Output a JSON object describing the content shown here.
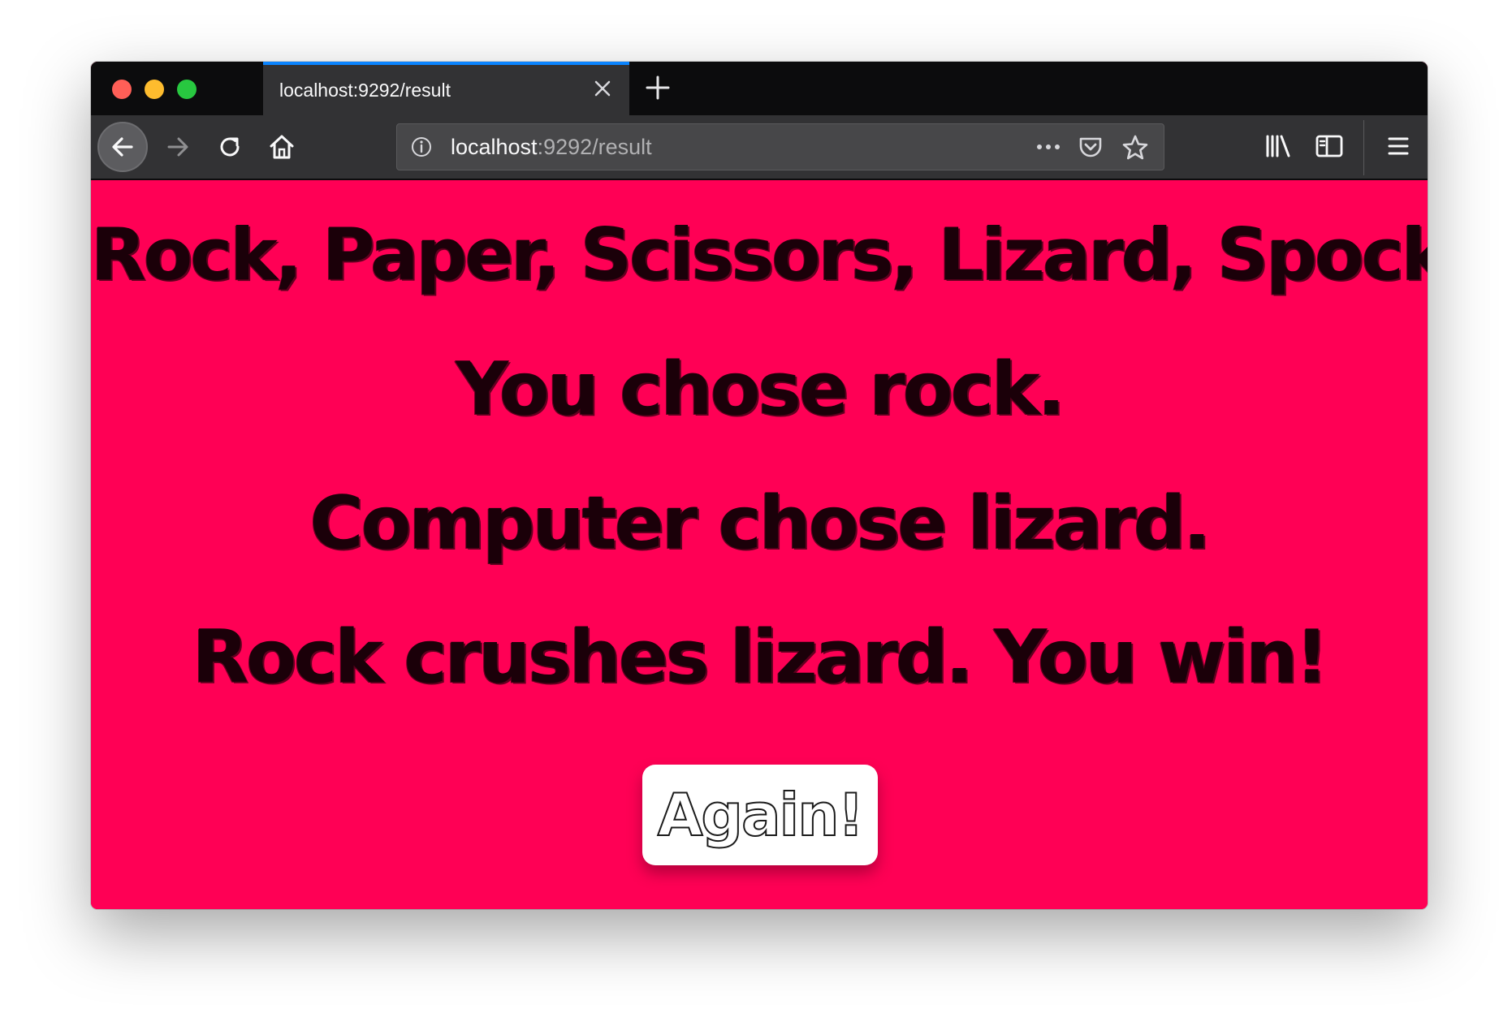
{
  "browser": {
    "tab_title": "localhost:9292/result",
    "url_host": "localhost",
    "url_rest": ":9292/result",
    "accent_color": "#0a84ff",
    "icons": [
      "back-arrow-icon",
      "forward-arrow-icon",
      "reload-icon",
      "home-icon",
      "info-icon",
      "more-icon",
      "pocket-icon",
      "star-icon",
      "library-icon",
      "sidebar-icon",
      "menu-icon",
      "close-icon",
      "plus-icon"
    ]
  },
  "page": {
    "background_color": "#ff0055",
    "heading": "Rock, Paper, Scissors, Lizard, Spock.",
    "player_choice": "You chose rock.",
    "computer_choice": "Computer chose lizard.",
    "result": "Rock crushes lizard. You win!",
    "again_button": "Again!"
  }
}
